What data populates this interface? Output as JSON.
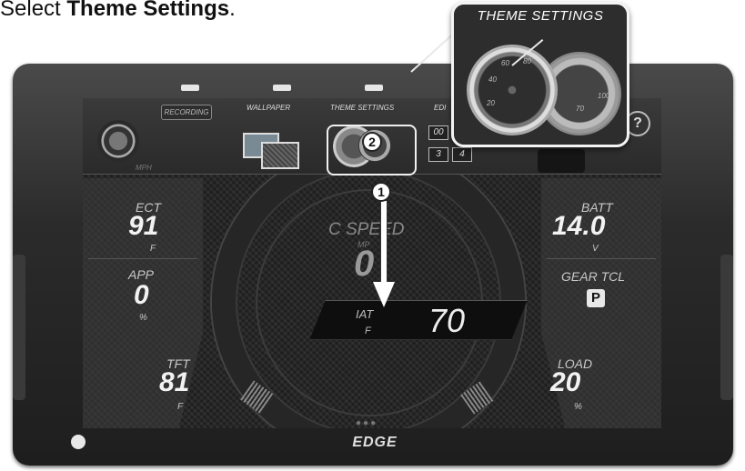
{
  "instruction": {
    "prefix": "Select ",
    "bold": "Theme Settings",
    "suffix": "."
  },
  "device": {
    "brand": "EDGE"
  },
  "menu": {
    "recording_label": "RECORDING",
    "wallpaper_label": "WALLPAPER",
    "theme_settings_label": "THEME SETTINGS",
    "edit_label": "EDI",
    "edit_boxes": [
      "00",
      "3",
      "4"
    ],
    "help_label": "?",
    "speed_unit": "MPH"
  },
  "callout": {
    "title": "THEME SETTINGS",
    "ticks": [
      "20",
      "40",
      "60",
      "80",
      "100",
      "70"
    ]
  },
  "steps": {
    "step1": "1",
    "step2": "2"
  },
  "gauges": {
    "ect": {
      "label": "ECT",
      "value": "91",
      "unit": "F"
    },
    "app": {
      "label": "APP",
      "value": "0",
      "unit": "%"
    },
    "tft": {
      "label": "TFT",
      "value": "81",
      "unit": "F"
    },
    "batt": {
      "label": "BATT",
      "value": "14.0",
      "unit": "V"
    },
    "gear": {
      "label": "GEAR TCL",
      "value": "P"
    },
    "load": {
      "label": "LOAD",
      "value": "20",
      "unit": "%"
    },
    "center": {
      "label": "C SPEED",
      "unit": "MP",
      "value": "0"
    },
    "iat": {
      "label": "IAT",
      "unit": "F",
      "value": "70"
    }
  },
  "page_indicator": "●●●"
}
